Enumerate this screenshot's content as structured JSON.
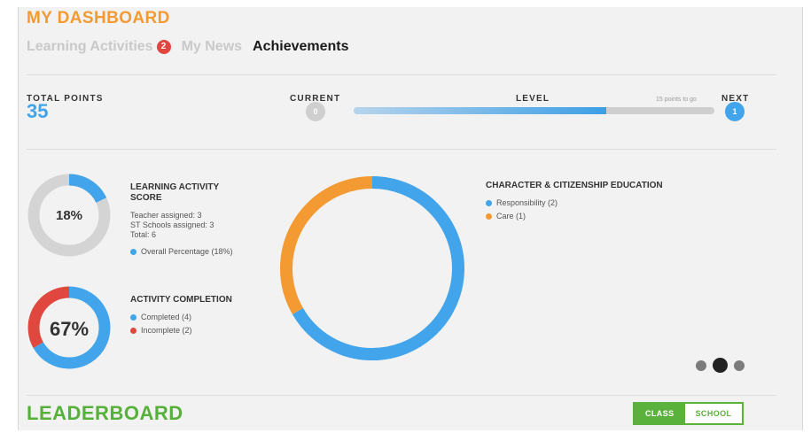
{
  "header": {
    "title": "MY DASHBOARD",
    "tabs": [
      {
        "label": "Learning Activities",
        "badge": "2",
        "active": false
      },
      {
        "label": "My News",
        "active": false
      },
      {
        "label": "Achievements",
        "active": true
      }
    ]
  },
  "stats": {
    "total_points_label": "TOTAL POINTS",
    "total_points": "35",
    "current_label": "CURRENT",
    "current_level": "0",
    "level_label": "LEVEL",
    "next_label": "NEXT",
    "next_level": "1",
    "progress_note": "15 points to go",
    "progress_fraction": 0.7
  },
  "learning_score": {
    "title": "LEARNING ACTIVITY SCORE",
    "percent_label": "18%",
    "percent": 18,
    "teacher": "Teacher assigned: 3",
    "st_schools": "ST Schools assigned: 3",
    "total": "Total: 6",
    "legend": "Overall Percentage (18%)",
    "color": "#42a4ea"
  },
  "activity_completion": {
    "title": "ACTIVITY COMPLETION",
    "percent_label": "67%",
    "completed_label": "Completed (4)",
    "incomplete_label": "Incomplete (2)",
    "completed": 4,
    "incomplete": 2,
    "completed_color": "#42a4ea",
    "incomplete_color": "#e0483f"
  },
  "character": {
    "title": "CHARACTER & CITIZENSHIP EDUCATION",
    "items": [
      {
        "label": "Responsibility (2)",
        "value": 2,
        "color": "#42a4ea"
      },
      {
        "label": "Care (1)",
        "value": 1,
        "color": "#f39a32"
      }
    ]
  },
  "leaderboard": {
    "title": "LEADERBOARD",
    "toggle": [
      {
        "label": "CLASS",
        "active": true
      },
      {
        "label": "SCHOOL",
        "active": false
      }
    ]
  }
}
